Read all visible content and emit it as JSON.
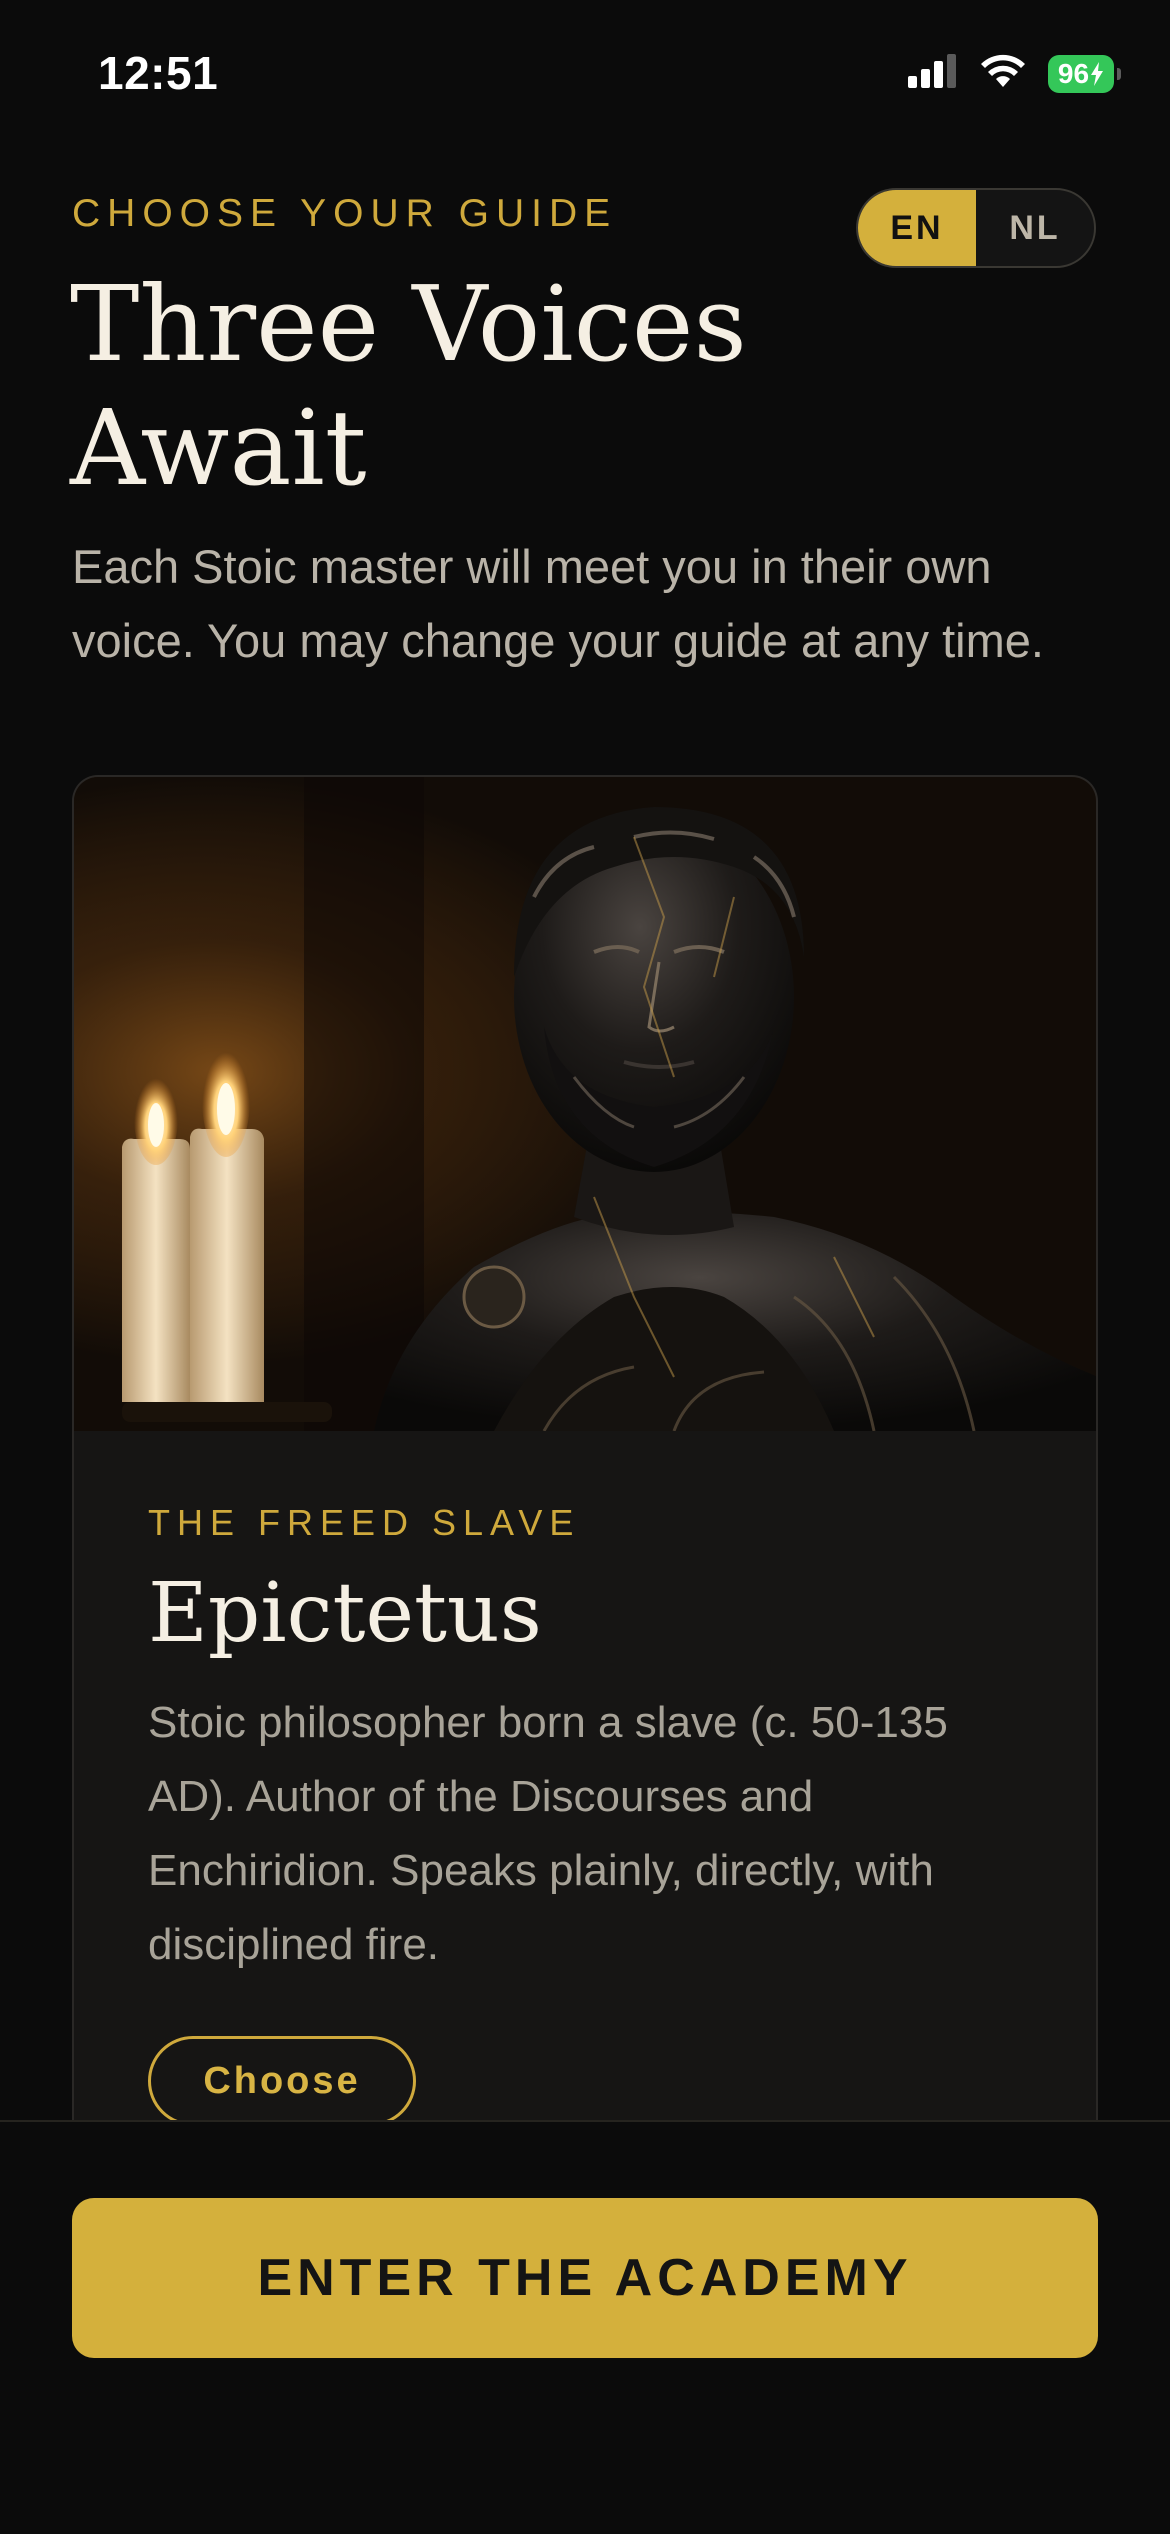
{
  "status_bar": {
    "time": "12:51",
    "battery": "96",
    "icons": [
      "signal-icon",
      "wifi-icon",
      "battery-charging-icon"
    ]
  },
  "header": {
    "eyebrow": "CHOOSE YOUR GUIDE",
    "title": "Three Voices Await",
    "intro": "Each Stoic master will meet you in their own voice. You may change your guide at any time."
  },
  "language": {
    "options": [
      "EN",
      "NL"
    ],
    "selected": "EN"
  },
  "guide_card": {
    "image": "marble-bust-with-candles",
    "eyebrow": "THE FREED SLAVE",
    "name": "Epictetus",
    "description": "Stoic philosopher born a slave (c. 50-135 AD). Author of the Discourses and Enchiridion. Speaks plainly, directly, with disciplined fire.",
    "choose_label": "Choose"
  },
  "footer": {
    "cta_label": "ENTER THE ACADEMY"
  },
  "colors": {
    "background": "#0b0b0b",
    "accent_gold": "#d4b03c",
    "card": "#161514",
    "battery_green": "#34c759"
  }
}
